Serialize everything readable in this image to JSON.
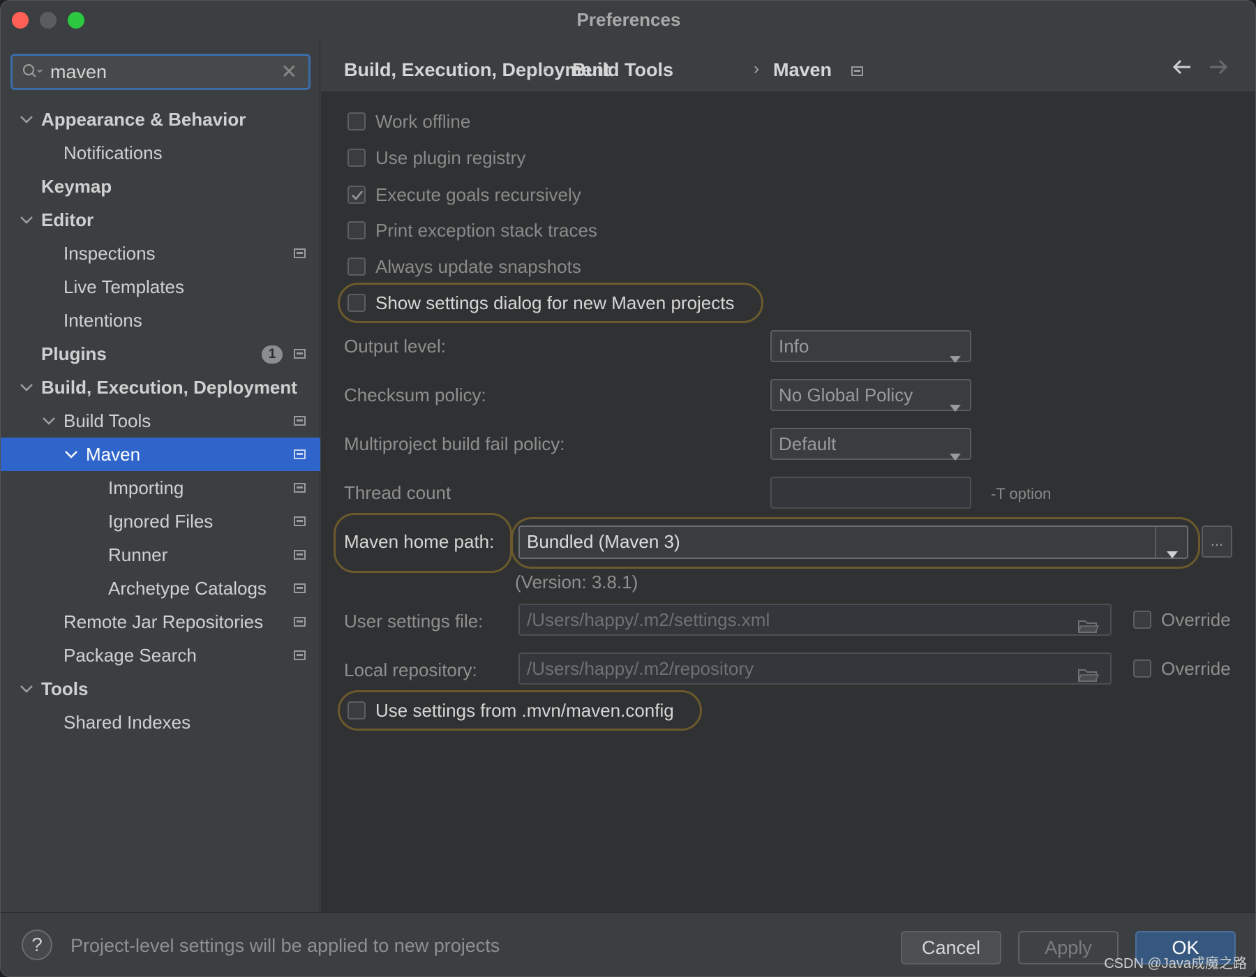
{
  "window": {
    "title": "Preferences"
  },
  "search": {
    "value": "maven",
    "clear_glyph": "✕"
  },
  "tree": [
    {
      "label": "Appearance & Behavior",
      "level": 0,
      "bold": true,
      "expanded": true,
      "pinned": false
    },
    {
      "label": "Notifications",
      "level": 1,
      "bold": false,
      "pinned": false
    },
    {
      "label": "Keymap",
      "level": 0,
      "bold": true,
      "pinned": false
    },
    {
      "label": "Editor",
      "level": 0,
      "bold": true,
      "expanded": true,
      "pinned": false
    },
    {
      "label": "Inspections",
      "level": 1,
      "bold": false,
      "pinned": true
    },
    {
      "label": "Live Templates",
      "level": 1,
      "bold": false,
      "pinned": false
    },
    {
      "label": "Intentions",
      "level": 1,
      "bold": false,
      "pinned": false
    },
    {
      "label": "Plugins",
      "level": 0,
      "bold": true,
      "pinned": true,
      "badge": "1"
    },
    {
      "label": "Build, Execution, Deployment",
      "level": 0,
      "bold": true,
      "expanded": true,
      "pinned": false
    },
    {
      "label": "Build Tools",
      "level": 1,
      "bold": false,
      "expanded": true,
      "pinned": true
    },
    {
      "label": "Maven",
      "level": 2,
      "bold": false,
      "expanded": true,
      "pinned": true,
      "selected": true
    },
    {
      "label": "Importing",
      "level": 3,
      "bold": false,
      "pinned": true
    },
    {
      "label": "Ignored Files",
      "level": 3,
      "bold": false,
      "pinned": true
    },
    {
      "label": "Runner",
      "level": 3,
      "bold": false,
      "pinned": true
    },
    {
      "label": "Archetype Catalogs",
      "level": 3,
      "bold": false,
      "pinned": true
    },
    {
      "label": "Remote Jar Repositories",
      "level": 1,
      "bold": false,
      "pinned": true
    },
    {
      "label": "Package Search",
      "level": 1,
      "bold": false,
      "pinned": true
    },
    {
      "label": "Tools",
      "level": 0,
      "bold": true,
      "expanded": true,
      "pinned": false
    },
    {
      "label": "Shared Indexes",
      "level": 1,
      "bold": false,
      "pinned": false
    }
  ],
  "breadcrumb": {
    "items": [
      "Build, Execution, Deployment",
      "Build Tools",
      "Maven"
    ],
    "separator": "›"
  },
  "options": {
    "work_offline": {
      "label": "Work offline",
      "checked": false
    },
    "plugin_registry": {
      "label": "Use plugin registry",
      "checked": false
    },
    "execute_recursively": {
      "label": "Execute goals recursively",
      "checked": true
    },
    "print_stack": {
      "label": "Print exception stack traces",
      "checked": false
    },
    "update_snapshots": {
      "label": "Always update snapshots",
      "checked": false
    },
    "show_dialog": {
      "label": "Show settings dialog for new Maven projects",
      "checked": false
    },
    "use_mvn_config": {
      "label": "Use settings from .mvn/maven.config",
      "checked": false
    }
  },
  "fields": {
    "output_level": {
      "label": "Output level:",
      "value": "Info"
    },
    "checksum_policy": {
      "label": "Checksum policy:",
      "value": "No Global Policy"
    },
    "fail_policy": {
      "label": "Multiproject build fail policy:",
      "value": "Default"
    },
    "thread_count": {
      "label": "Thread count",
      "value": "",
      "hint": "-T option"
    },
    "maven_home": {
      "label": "Maven home path:",
      "value": "Bundled (Maven 3)",
      "version": "(Version: 3.8.1)",
      "browse": "..."
    },
    "user_settings": {
      "label": "User settings file:",
      "value": "/Users/happy/.m2/settings.xml",
      "override": "Override"
    },
    "local_repo": {
      "label": "Local repository:",
      "value": "/Users/happy/.m2/repository",
      "override": "Override"
    }
  },
  "footer": {
    "help": "?",
    "text": "Project-level settings will be applied to new projects",
    "cancel": "Cancel",
    "apply": "Apply",
    "ok": "OK"
  },
  "watermark": "CSDN @Java成魔之路",
  "colors": {
    "accent": "#2f65ca",
    "highlight": "#6b5a2c",
    "primary_button": "#365880"
  }
}
